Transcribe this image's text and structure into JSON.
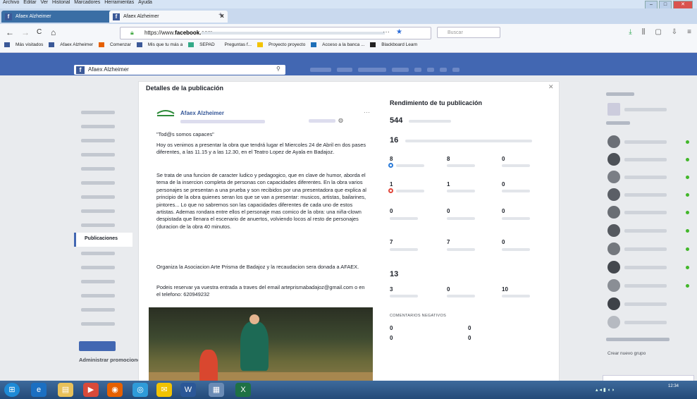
{
  "browser": {
    "menu": [
      "Archivo",
      "Editar",
      "Ver",
      "Historial",
      "Marcadores",
      "Herramientas",
      "Ayuda"
    ],
    "tabs": [
      {
        "label": "Afaex Alzheimer"
      },
      {
        "label": "Afaex Alzheimer",
        "close": "×"
      }
    ],
    "new_tab": "+",
    "nav": {
      "back": "←",
      "forward": "→",
      "reload": "C",
      "home": "⌂"
    },
    "url": {
      "domain": "facebook.com",
      "prefix": "https://www."
    },
    "search_placeholder": "Buscar",
    "window_controls": {
      "minimize": "–",
      "maximize": "□",
      "close": "✕"
    },
    "tool_icons": [
      "⤓",
      "⫼",
      "▢",
      "⇩",
      "≡"
    ],
    "bookmarks": [
      "Más visitados",
      "Afaex Alzheimer",
      "Comenzar",
      "Mis que tu más a",
      "SEPAD",
      "Preguntas f...",
      "Proyecto proyecto",
      "Acceso a la banca ...",
      "Blackboard Learn"
    ]
  },
  "facebook": {
    "search_value": "Afaex Alzheimer",
    "search_icon": "⚲",
    "left_nav_active": "Publicaciones",
    "admin_link": "Administrar promociones",
    "right": {
      "create_group": "Crear nuevo grupo"
    }
  },
  "post_panel": {
    "title": "Detalles de la publicación",
    "close": "✕",
    "page_name": "Afaex Alzheimer",
    "more": "···",
    "globe": "◍",
    "paragraphs": [
      "\"Tod@s somos capaces\"",
      "Hoy os venimos a presentar la obra que tendrá lugar el Miercoles 24 de Abril en dos pases diferentes, a las 11.15 y a las 12.30, en el Teatro Lopez de Ayala en Badajoz.",
      "Se trata de una funcion de caracter ludico y pedagogico, que en clave de humor, aborda el tema de la insercion completa de personas con capacidades diferentes. En la obra varios personajes se presentan a una prueba y son recibidos por una presentadora que explica al principio de la obra quienes seran los que se van a presentar: musicos, artistas, bailarines, pintores... Lo que no sabremos son las capacidades diferentes de cada uno de estos artistas. Ademas rondara entre ellos el personaje mas comico de la obra: una niña-clown despistada que llenara el escenario de anuertos, volviendo locos al resto de personajes (duracion de la obra 40 minutos.",
      "Organiza la Asociacion Arte Prisma de Badajoz y la recaudacion sera donada a AFAEX.",
      "Podeis reservar ya vuestra entrada a traves del email arteprismabadajoz@gmail.com o en el telefono: 620949232"
    ]
  },
  "stats": {
    "title": "Rendimiento de tu publicación",
    "reach": "544",
    "reactions": "16",
    "row1": [
      "8",
      "8",
      "0"
    ],
    "row2": [
      "1",
      "1",
      "0"
    ],
    "row3": [
      "0",
      "0",
      "0"
    ],
    "row4": [
      "7",
      "7",
      "0"
    ],
    "clicks": "13",
    "clicks_row": [
      "3",
      "0",
      "10"
    ],
    "negative_label": "COMENTARIOS NEGATIVOS",
    "neg_row1": [
      "0",
      "0"
    ],
    "neg_row2": [
      "0",
      "0"
    ]
  },
  "taskbar": {
    "start": "⊞",
    "apps": [
      "e",
      "▤",
      "▶",
      "◉",
      "◎",
      "✉",
      "W",
      "▦",
      "X"
    ],
    "clock": "12:34"
  },
  "colors": {
    "facebook_blue": "#4267b2",
    "link_blue": "#365899",
    "reaction_blue": "#2b7bd9",
    "reaction_red": "#e0463b"
  }
}
